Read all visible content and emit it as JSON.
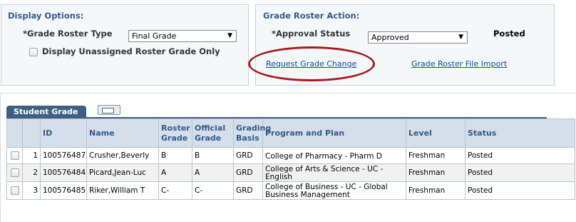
{
  "display_options": {
    "title": "Display Options:",
    "roster_type_label": "*Grade Roster Type",
    "roster_type_value": "Final Grade",
    "unassigned_label": "Display Unassigned Roster Grade Only"
  },
  "roster_action": {
    "title": "Grade Roster Action:",
    "approval_label": "*Approval Status",
    "approval_value": "Approved",
    "posted_text": "Posted",
    "request_change_link": "Request Grade Change",
    "file_import_link": "Grade Roster File Import"
  },
  "grid": {
    "tab_label": "Student Grade",
    "columns": [
      "",
      "",
      "ID",
      "Name",
      "Roster Grade",
      "Official Grade",
      "Grading Basis",
      "Program and Plan",
      "Level",
      "Status"
    ],
    "rows": [
      {
        "num": "1",
        "id": "100576487",
        "name": "Crusher,Beverly",
        "roster": "B",
        "official": "B",
        "basis": "GRD",
        "program": "College of Pharmacy - Pharm D",
        "level": "Freshman",
        "status": "Posted"
      },
      {
        "num": "2",
        "id": "100576484",
        "name": "Picard,Jean-Luc",
        "roster": "A",
        "official": "A",
        "basis": "GRD",
        "program": "College of Arts & Science - UC - English",
        "level": "Freshman",
        "status": "Posted"
      },
      {
        "num": "3",
        "id": "100576485",
        "name": "Riker,William T",
        "roster": "C-",
        "official": "C-",
        "basis": "GRD",
        "program": "College of Business - UC - Global Business Management",
        "level": "Freshman",
        "status": "Posted"
      }
    ]
  },
  "colors": {
    "accent": "#325a8c",
    "tab": "#3d5f82",
    "highlight": "#a51c1c",
    "link": "#0b4aa8"
  },
  "icons": [
    "dropdown-arrow-icon",
    "checkbox-icon",
    "grid-view-icon"
  ]
}
